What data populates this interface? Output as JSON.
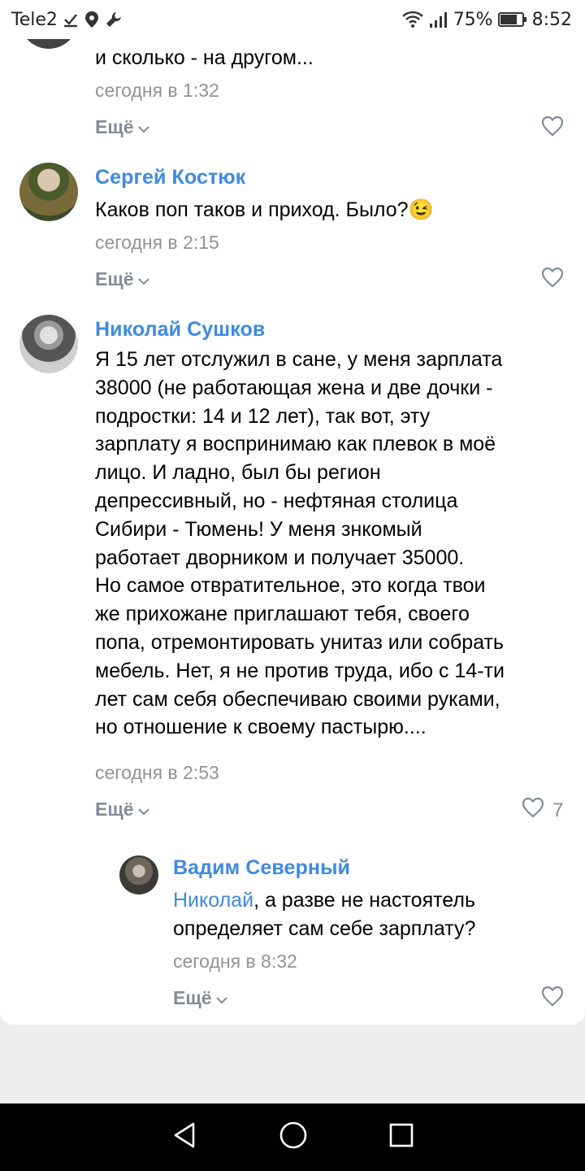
{
  "status_bar": {
    "carrier": "Tele2",
    "battery": "75%",
    "time": "8:52"
  },
  "comments": [
    {
      "text_tail": "и сколько - на другом...",
      "time": "сегодня в 1:32",
      "more": "Ещё"
    },
    {
      "author": "Сергей Костюк",
      "text": "Каков поп таков и приход. Было?",
      "emoji": "😉",
      "time": "сегодня в 2:15",
      "more": "Ещё"
    },
    {
      "author": "Николай Сушков",
      "text": "Я 15 лет отслужил в сане, у меня зарплата\n38000 (не работающая жена и две дочки -\nподростки: 14 и 12 лет), так вот, эту\nзарплату я воспринимаю как плевок в моё\nлицо. И ладно, был бы регион\nдепрессивный, но - нефтяная столица\nСибири - Тюмень! У меня знкомый\nработает дворником и получает 35000.\nНо самое отвратительное, это когда твои\nже прихожане приглашают тебя, своего\nпопа, отремонтировать унитаз или собрать\nмебель. Нет, я не против труда, ибо с 14-ти\nлет сам себя обеспечиваю своими руками,\nно отношение к своему пастырю....",
      "time": "сегодня в 2:53",
      "more": "Ещё",
      "likes": "7"
    },
    {
      "author": "Вадим Северный",
      "mention": "Николай",
      "text": ", а разве не настоятель\nопределяет сам себе зарплату?",
      "time": "сегодня в 8:32",
      "more": "Ещё"
    }
  ],
  "icons": {
    "like": "heart-outline-icon",
    "more": "chevron-down-icon",
    "nav_back": "triangle-back-icon",
    "nav_home": "circle-home-icon",
    "nav_recents": "square-recents-icon"
  }
}
